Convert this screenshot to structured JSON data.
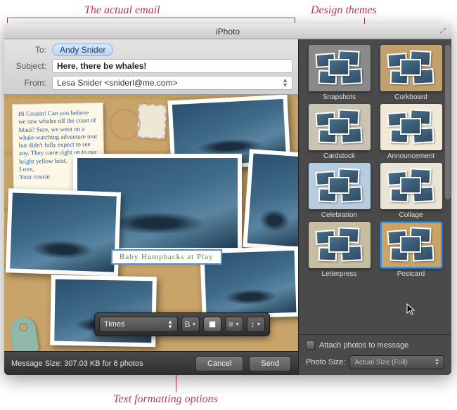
{
  "annotations": {
    "actual_email": "The actual email",
    "design_themes": "Design themes",
    "text_formatting": "Text formatting options"
  },
  "window": {
    "title": "iPhoto"
  },
  "email": {
    "to_label": "To:",
    "to_value": "Andy Snider",
    "subject_label": "Subject:",
    "subject_value": "Here, there be whales!",
    "from_label": "From:",
    "from_value": "Lesa Snider <sniderl@me.com>",
    "note_text": "Hi Cousin! Can you believe we saw whales off the coast of Maui? Sure, we went on a whale-watching adventure tour but didn't fully expect to see any. They came right up to our bright yellow boat.\nLove,\nYour cousin",
    "caption": "Baby Humpbacks at Play"
  },
  "format": {
    "font": "Times",
    "bold_glyph": "B",
    "align_glyph": "≡",
    "spacing_glyph": "↕"
  },
  "footer": {
    "message_size": "Message Size: 307.03 KB for 6 photos",
    "cancel": "Cancel",
    "send": "Send"
  },
  "themes": {
    "items": [
      {
        "label": "Snapshots",
        "bg": "#8a8a8a"
      },
      {
        "label": "Corkboard",
        "bg": "#c2a06e"
      },
      {
        "label": "Cardstock",
        "bg": "#c9c4b4"
      },
      {
        "label": "Announcement",
        "bg": "#efe9d6"
      },
      {
        "label": "Celebration",
        "bg": "#b8ccdf"
      },
      {
        "label": "Collage",
        "bg": "#e9e4d6"
      },
      {
        "label": "Letterpress",
        "bg": "#c7bda0"
      },
      {
        "label": "Postcard",
        "bg": "#caa368",
        "selected": true
      }
    ],
    "attach_label": "Attach photos to message",
    "photo_size_label": "Photo Size:",
    "photo_size_value": "Actual Size (Full)"
  }
}
